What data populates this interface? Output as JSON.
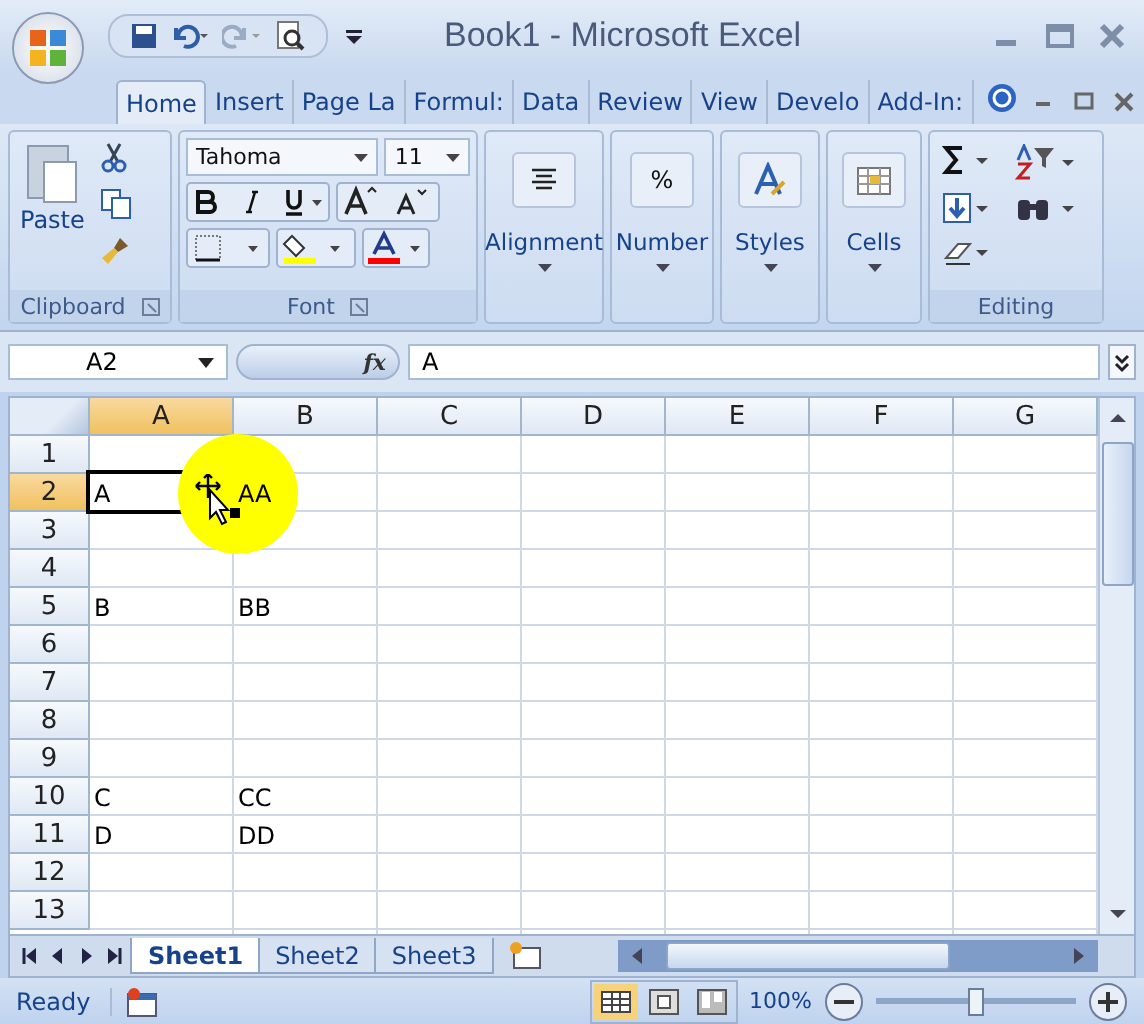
{
  "window": {
    "title": "Book1 - Microsoft Excel"
  },
  "tabs": [
    {
      "label": "Home",
      "selected": true
    },
    {
      "label": "Insert",
      "selected": false
    },
    {
      "label": "Page La",
      "selected": false
    },
    {
      "label": "Formul:",
      "selected": false
    },
    {
      "label": "Data",
      "selected": false
    },
    {
      "label": "Review",
      "selected": false
    },
    {
      "label": "View",
      "selected": false
    },
    {
      "label": "Develo",
      "selected": false
    },
    {
      "label": "Add-In:",
      "selected": false
    }
  ],
  "ribbon": {
    "paste": "Paste",
    "clipboard": "Clipboard",
    "font_name": "Tahoma",
    "font_size": "11",
    "font": "Font",
    "groups": [
      "Alignment",
      "Number",
      "Styles",
      "Cells"
    ],
    "editing": "Editing",
    "number_symbol": "%"
  },
  "formula_bar": {
    "name_box": "A2",
    "fx": "fx",
    "value": "A"
  },
  "columns": [
    {
      "label": "A",
      "selected": true
    },
    {
      "label": "B",
      "selected": false
    },
    {
      "label": "C",
      "selected": false
    },
    {
      "label": "D",
      "selected": false
    },
    {
      "label": "E",
      "selected": false
    },
    {
      "label": "F",
      "selected": false
    },
    {
      "label": "G",
      "selected": false
    }
  ],
  "rows": [
    {
      "label": "1",
      "selected": false,
      "cells": []
    },
    {
      "label": "2",
      "selected": true,
      "cells": [
        "A",
        "AA"
      ]
    },
    {
      "label": "3",
      "selected": false,
      "cells": []
    },
    {
      "label": "4",
      "selected": false,
      "cells": []
    },
    {
      "label": "5",
      "selected": false,
      "cells": [
        "B",
        "BB"
      ]
    },
    {
      "label": "6",
      "selected": false,
      "cells": []
    },
    {
      "label": "7",
      "selected": false,
      "cells": []
    },
    {
      "label": "8",
      "selected": false,
      "cells": []
    },
    {
      "label": "9",
      "selected": false,
      "cells": []
    },
    {
      "label": "10",
      "selected": false,
      "cells": [
        "C",
        "CC"
      ]
    },
    {
      "label": "11",
      "selected": false,
      "cells": [
        "D",
        "DD"
      ]
    },
    {
      "label": "12",
      "selected": false,
      "cells": []
    },
    {
      "label": "13",
      "selected": false,
      "cells": []
    }
  ],
  "sheets": [
    {
      "label": "Sheet1",
      "selected": true
    },
    {
      "label": "Sheet2",
      "selected": false
    },
    {
      "label": "Sheet3",
      "selected": false
    }
  ],
  "status_bar": {
    "status": "Ready",
    "zoom": "100%",
    "zoom_slider": {
      "level": 0.5
    }
  }
}
